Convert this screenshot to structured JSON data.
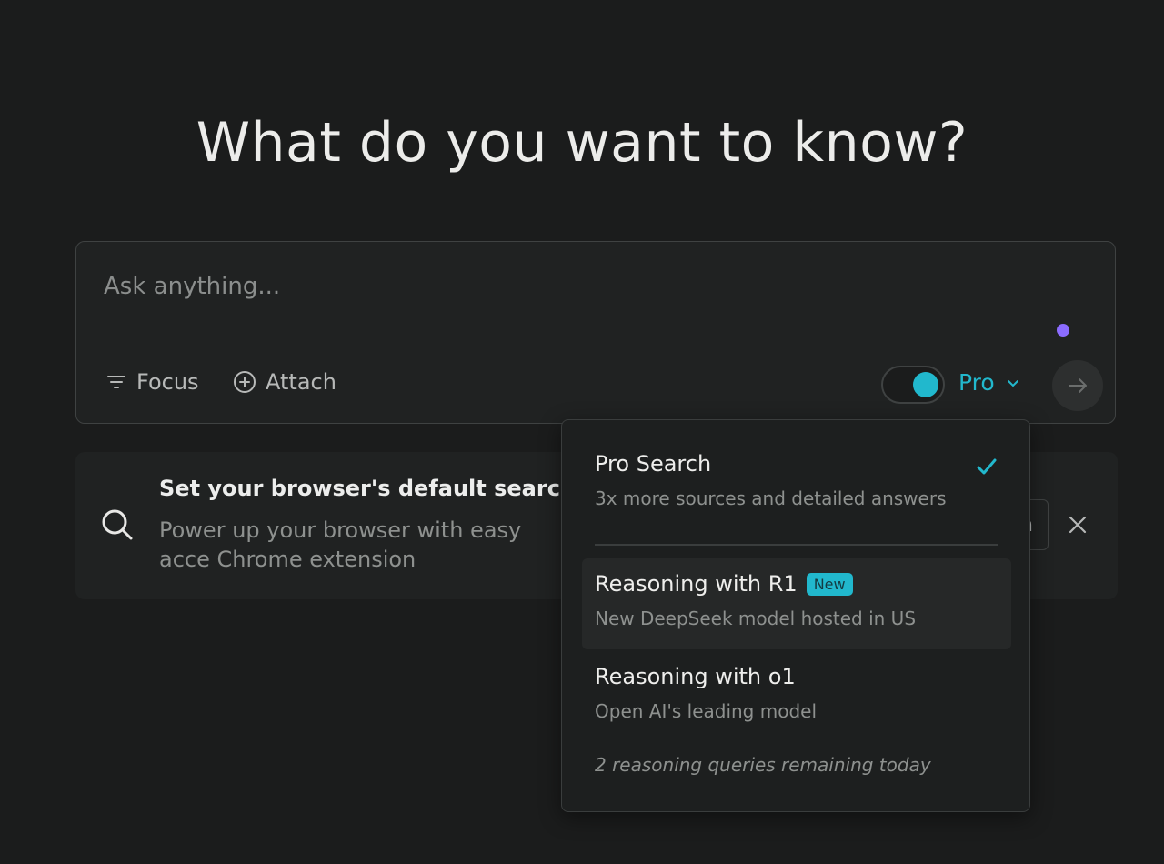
{
  "headline": "What do you want to know?",
  "search": {
    "placeholder": "Ask anything...",
    "focus_label": "Focus",
    "attach_label": "Attach",
    "mode_label": "Pro",
    "pro_toggle_on": true
  },
  "banner": {
    "title": "Set your browser's default search eng",
    "body": "Power up your browser with easy acce Chrome extension",
    "button_partial": "n"
  },
  "dropdown": {
    "options": [
      {
        "title": "Pro Search",
        "desc": "3x more sources and detailed answers",
        "selected": true
      },
      {
        "title": "Reasoning with R1",
        "badge": "New",
        "desc": "New DeepSeek model hosted in US"
      },
      {
        "title": "Reasoning with o1",
        "desc": "Open AI's leading model"
      }
    ],
    "remaining": "2 reasoning queries remaining today"
  },
  "colors": {
    "accent": "#21b8cd",
    "background": "#1b1c1c",
    "dot": "#8b6cff"
  }
}
